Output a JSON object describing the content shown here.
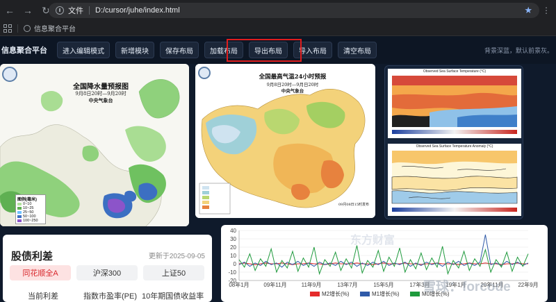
{
  "browser": {
    "scheme_label": "文件",
    "url": "D:/cursor/juhe/index.html",
    "bookmark": "信息聚合平台"
  },
  "toolbar": {
    "brand": "信息聚合平台",
    "buttons": [
      "进入编辑模式",
      "新增模块",
      "保存布局",
      "加载布局",
      "导出布局",
      "导入布局",
      "清空布局"
    ],
    "hint": "背景深蓝，默认前景灰。"
  },
  "rain_map": {
    "title": "全国降水量预报图",
    "period": "9月8日20时—9月20时",
    "issuer": "中央气象台",
    "legend_title": "图例(毫米)",
    "legend_items": [
      "0~10",
      "10~25",
      "25~50",
      "50~100",
      "100~250"
    ]
  },
  "temp_map": {
    "title": "全国最高气温24小时预报",
    "period": "9月8日20时—9月日20时",
    "issuer": "中央气象台",
    "footer": "09月08日15时发布"
  },
  "sst": {
    "top_caption": "Observed Sea Surface Temperature (°C)",
    "bottom_caption": "Observed Sea Surface Temperature Anomaly (°C)"
  },
  "bond": {
    "title": "股债利差",
    "updated": "更新于2025-09-05",
    "tabs": [
      "同花顺全A",
      "沪深300",
      "上证50"
    ],
    "columns": [
      "当前利差",
      "指数市盈率(PE)",
      "10年期国债收益率"
    ]
  },
  "money_chart": {
    "watermark": "东方财富",
    "watermark2": "雪球：forcode"
  },
  "colors": {
    "app_bg": "#0f1a2b",
    "toolbar_bg": "#0d1624",
    "highlight_box": "#e01d1d",
    "m2": "#e52b2b",
    "m1": "#2f5aa8",
    "m0": "#1e9a3c"
  },
  "chart_data": {
    "type": "line",
    "x_ticks": [
      "08年1月",
      "09年11月",
      "11年9月",
      "13年7月",
      "15年5月",
      "17年3月",
      "19年1月",
      "20年11月",
      "22年9月"
    ],
    "y_ticks": [
      -20,
      -10,
      0,
      10,
      20,
      30,
      40
    ],
    "ylim": [
      -20,
      40
    ],
    "series": [
      {
        "name": "M2增长(%)",
        "color": "#e52b2b",
        "values": [
          0,
          1,
          0,
          -1,
          0,
          1,
          0,
          0,
          1,
          0,
          -1,
          0,
          0,
          1,
          0,
          0,
          -1,
          0,
          1,
          0,
          0,
          0,
          1,
          0,
          0,
          -1,
          0,
          1,
          0,
          0,
          0,
          1,
          0,
          0,
          -1,
          0,
          0,
          1,
          0,
          0,
          0,
          -1,
          0,
          1,
          0,
          0,
          1,
          0,
          0,
          -1,
          0,
          0,
          1,
          0,
          0
        ]
      },
      {
        "name": "M1增长(%)",
        "color": "#2f5aa8",
        "values": [
          -1,
          2,
          -3,
          1,
          -2,
          3,
          -1,
          1,
          -4,
          2,
          -1,
          3,
          -2,
          1,
          -3,
          2,
          -1,
          1,
          -2,
          3,
          -1,
          2,
          -3,
          1,
          -2,
          2,
          -1,
          3,
          -2,
          1,
          -1,
          2,
          -3,
          1,
          -2,
          2,
          -1,
          1,
          -3,
          2,
          -1,
          3,
          -2,
          1,
          -2,
          2,
          35,
          -1,
          1,
          -2,
          3,
          -1,
          2,
          -2,
          1
        ]
      },
      {
        "name": "M0增长(%)",
        "color": "#1e9a3c",
        "values": [
          5,
          -4,
          12,
          -8,
          6,
          -3,
          18,
          -10,
          4,
          -5,
          15,
          -9,
          7,
          -4,
          20,
          -12,
          5,
          -3,
          14,
          -8,
          6,
          -5,
          22,
          -11,
          4,
          -4,
          16,
          -9,
          8,
          -3,
          19,
          -10,
          5,
          -6,
          13,
          -7,
          7,
          -4,
          21,
          -12,
          4,
          -5,
          15,
          -8,
          6,
          -3,
          17,
          -10,
          5,
          -4,
          14,
          -9,
          8,
          -3,
          12
        ]
      }
    ]
  }
}
